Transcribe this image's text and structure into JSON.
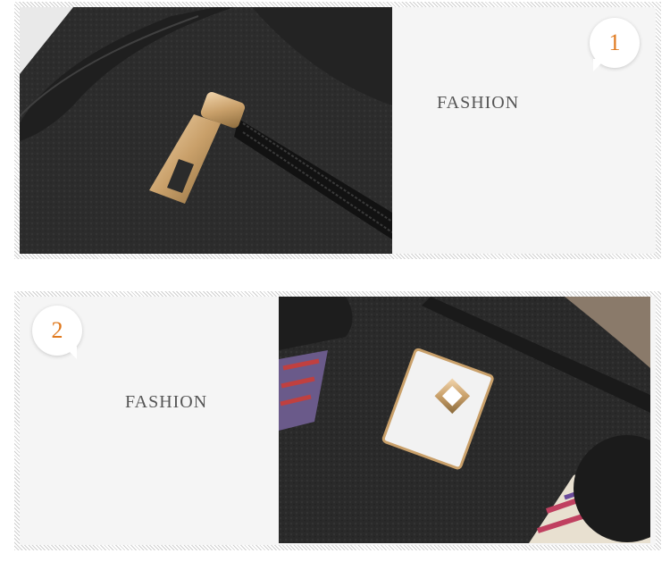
{
  "section1": {
    "number": "1",
    "caption": "FASHION"
  },
  "section2": {
    "number": "2",
    "caption": "FASHION"
  },
  "colors": {
    "accent_number": "#e07a1f",
    "caption": "#555555",
    "leather": "#2b2b2b",
    "gold": "#c9a06a"
  },
  "icons": [
    "speech-bubble-icon"
  ]
}
